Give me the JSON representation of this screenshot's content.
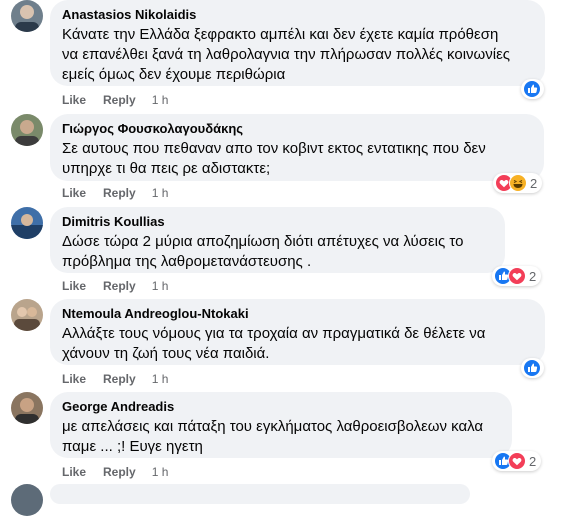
{
  "actions": {
    "like": "Like",
    "reply": "Reply"
  },
  "comments": [
    {
      "author": "Anastasios Nikolaidis",
      "lines": [
        "Κάνατε την Ελλάδα ξεφρακτο αμπέλι και δεν έχετε καμία πρόθεση",
        "να επανέλθει ξανά τη λαθρολαγνια την πλήρωσαν πολλές κοινωνίες",
        "εμείς όμως δεν έχουμε περιθώρια"
      ],
      "time": "1 h",
      "reactions": [
        "like"
      ],
      "reaction_count": ""
    },
    {
      "author": "Γιώργος Φουσκολαγουδάκης",
      "lines": [
        "Σε αυτους που πεθαναν απο τον κοβιντ εκτος εντατικης που δεν",
        "υπηρχε τι θα πεις ρε αδιστακτε;"
      ],
      "time": "1 h",
      "reactions": [
        "love",
        "haha"
      ],
      "reaction_count": "2"
    },
    {
      "author": "Dimitris Koullias",
      "lines": [
        "Δώσε τώρα 2 μύρια αποζημίωση διότι απέτυχες να λύσεις το",
        "πρόβλημα της λαθρομετανάστευσης ."
      ],
      "time": "1 h",
      "reactions": [
        "like",
        "love"
      ],
      "reaction_count": "2"
    },
    {
      "author": "Ntemoula Andreoglou-Ntokaki",
      "lines": [
        "Αλλάξτε τους νόμους για τα τροχαία αν πραγματικά δε θέλετε να",
        "χάνουν τη ζωή τους νέα παιδιά."
      ],
      "time": "1 h",
      "reactions": [
        "like"
      ],
      "reaction_count": ""
    },
    {
      "author": "George Andreadis",
      "lines": [
        "με απελάσεις και πάταξη του εγκλήματος λαθροεισβολεων καλα",
        "παμε ... ;! Ευγε ηγετη"
      ],
      "time": "1 h",
      "reactions": [
        "like",
        "love"
      ],
      "reaction_count": "2"
    }
  ],
  "colors": {
    "bubble": "#f0f2f5",
    "secondary_text": "#65676b",
    "like_blue": "#1877f2",
    "love_red": "#f33e58",
    "haha_yellow": "#f7b125"
  }
}
